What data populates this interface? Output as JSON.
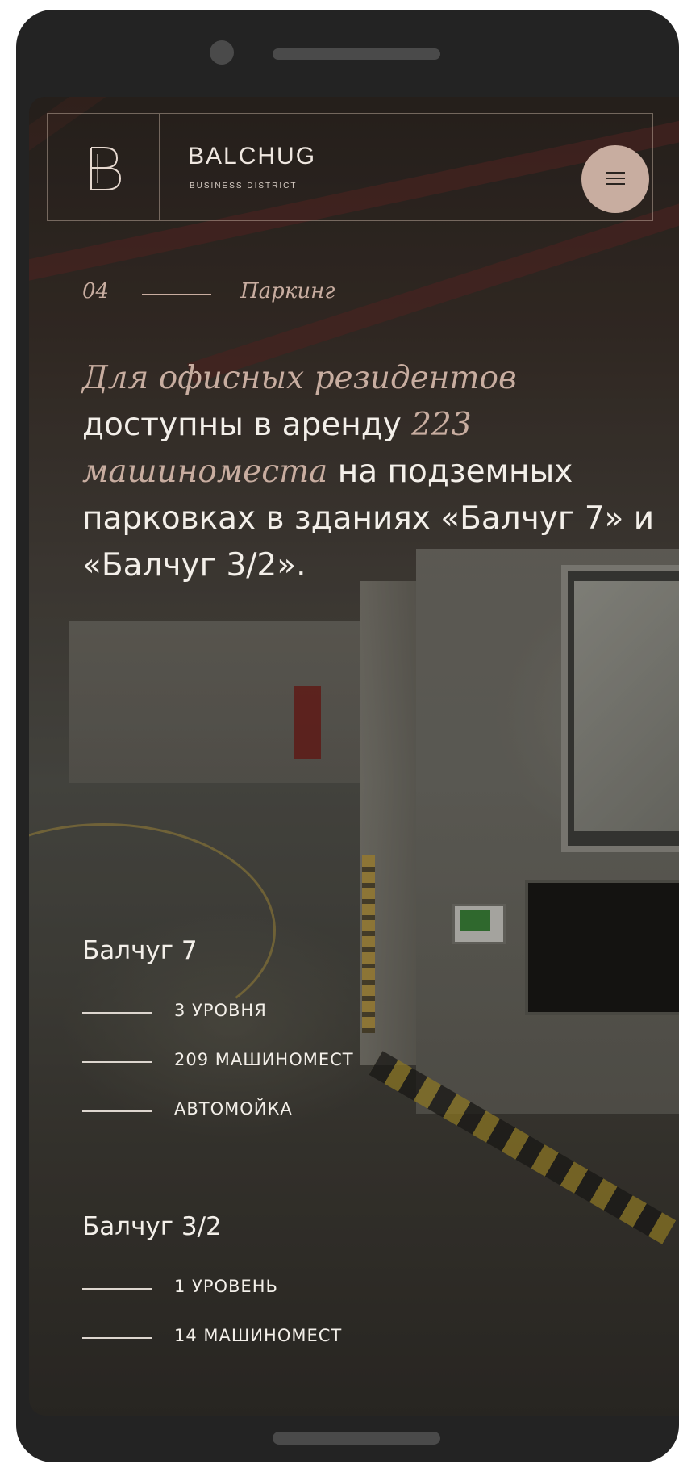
{
  "header": {
    "brand_name": "BALCHUG",
    "brand_sub": "BUSINESS DISTRICT",
    "menu_icon": "hamburger-icon"
  },
  "section": {
    "number": "04",
    "name": "Паркинг"
  },
  "intro": {
    "part1": "Для офисных резидентов",
    "part2": " доступны в аренду ",
    "part3": "223 машиноместа",
    "part4": " на подземных парковках в зданиях «Балчуг 7» и «Балчуг 3/2»."
  },
  "buildings": [
    {
      "title": "Балчуг 7",
      "features": [
        "3 УРОВНЯ",
        "209 МАШИНОМЕСТ",
        "АВТОМОЙКА"
      ]
    },
    {
      "title": "Балчуг 3/2",
      "features": [
        "1 УРОВЕНЬ",
        "14 МАШИНОМЕСТ"
      ]
    }
  ],
  "colors": {
    "accent": "#c8ada0",
    "text": "#f3efe9",
    "device": "#232323"
  }
}
